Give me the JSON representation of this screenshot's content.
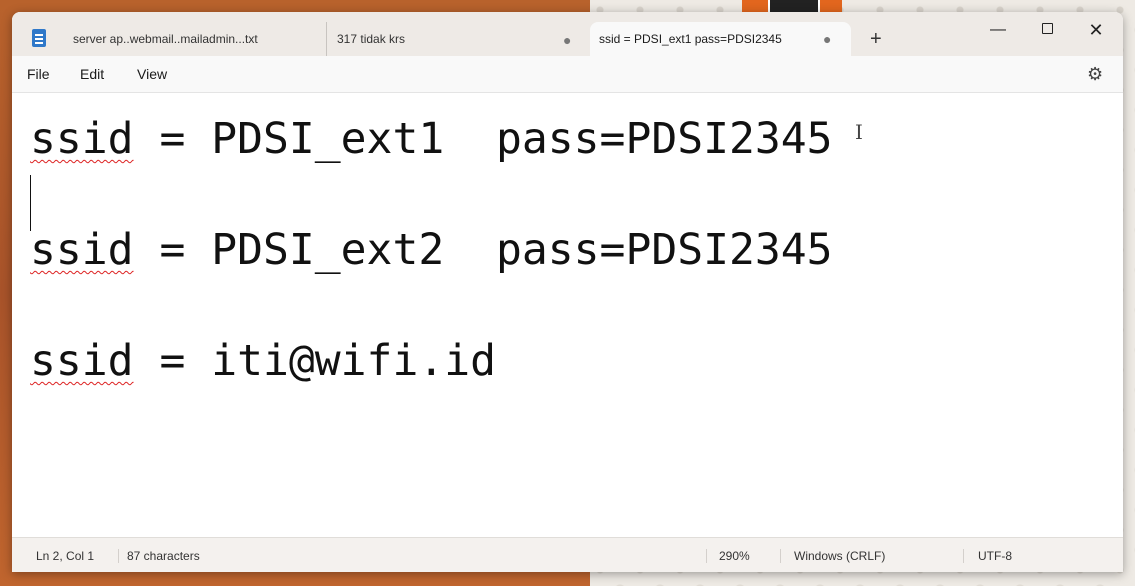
{
  "tabs": [
    {
      "label": "server ap..webmail..mailadmin...txt",
      "modified": false
    },
    {
      "label": "317 tidak krs",
      "modified": true,
      "modified_glyph": "●"
    },
    {
      "label": "ssid = PDSI_ext1  pass=PDSI2345",
      "modified": true,
      "modified_glyph": "●",
      "active": true
    }
  ],
  "new_tab_glyph": "+",
  "window_controls": {
    "minimize": "—",
    "maximize": "",
    "close": "✕"
  },
  "menu": {
    "file": "File",
    "edit": "Edit",
    "view": "View"
  },
  "settings_glyph": "⚙",
  "editor": {
    "lines": [
      {
        "ssid": "ssid",
        "rest": " = PDSI_ext1  pass=PDSI2345"
      },
      {
        "ssid": "ssid",
        "rest": " = PDSI_ext2  pass=PDSI2345"
      },
      {
        "ssid": "ssid",
        "rest": " = iti@wifi.id"
      }
    ],
    "cursor_glyph": "I"
  },
  "status": {
    "position": "Ln 2, Col 1",
    "characters": "87 characters",
    "zoom": "290%",
    "line_ending": "Windows (CRLF)",
    "encoding": "UTF-8"
  },
  "colors": {
    "accent_tab_active": "#f9f9f9",
    "spellcheck": "#dd2222",
    "desktop_left": "#b8622c"
  }
}
